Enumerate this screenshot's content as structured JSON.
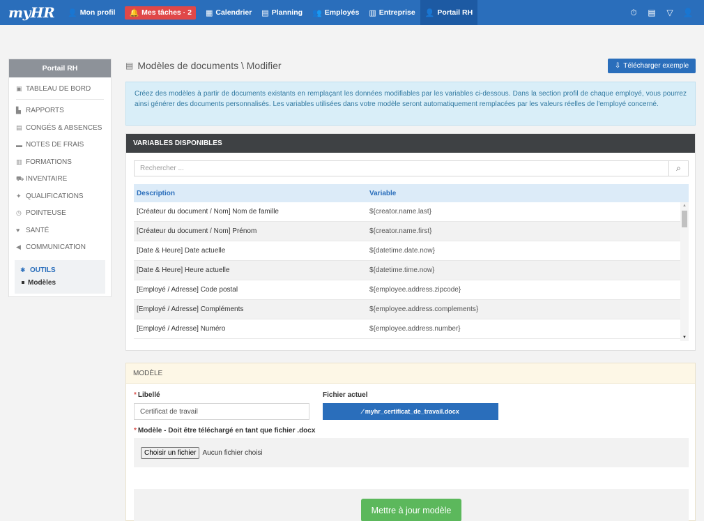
{
  "brand": "myHR",
  "nav": {
    "items": [
      {
        "icon": "👤",
        "label": "Mon profil"
      },
      {
        "icon": "🔔",
        "label": "Mes tâches · 2"
      },
      {
        "icon": "▦",
        "label": "Calendrier"
      },
      {
        "icon": "▤",
        "label": "Planning"
      },
      {
        "icon": "👥",
        "label": "Employés"
      },
      {
        "icon": "▥",
        "label": "Entreprise"
      },
      {
        "icon": "👤",
        "label": "Portail RH"
      }
    ],
    "right_icons": [
      "⏱",
      "▤",
      "▽",
      "👤"
    ]
  },
  "sidebar": {
    "title": "Portail RH",
    "items": [
      {
        "icon": "▣",
        "label": "TABLEAU DE BORD"
      },
      {
        "icon": "▙",
        "label": "RAPPORTS"
      },
      {
        "icon": "▤",
        "label": "CONGÉS & ABSENCES"
      },
      {
        "icon": "▬",
        "label": "NOTES DE FRAIS"
      },
      {
        "icon": "▥",
        "label": "FORMATIONS"
      },
      {
        "icon": "⛟",
        "label": "INVENTAIRE"
      },
      {
        "icon": "✦",
        "label": "QUALIFICATIONS"
      },
      {
        "icon": "◷",
        "label": "POINTEUSE"
      },
      {
        "icon": "♥",
        "label": "SANTÉ"
      },
      {
        "icon": "◀",
        "label": "COMMUNICATION"
      }
    ],
    "active": {
      "icon": "✱",
      "label": "OUTILS",
      "sub": "Modèles"
    }
  },
  "page": {
    "title_icon": "▤",
    "title": "Modèles de documents \\ Modifier",
    "download_icon": "⇩",
    "download_label": "Télécharger exemple",
    "info": "Créez des modèles à partir de documents existants en remplaçant les données modifiables par les variables ci-dessous. Dans la section profil de chaque employé, vous pourrez ainsi générer des documents personnalisés. Les variables utilisées dans votre modèle seront automatiquement remplacées par les valeurs réelles de l'employé concerné."
  },
  "variables": {
    "header": "VARIABLES DISPONIBLES",
    "search_placeholder": "Rechercher ...",
    "search_icon": "⌕",
    "col_desc": "Description",
    "col_var": "Variable",
    "rows": [
      {
        "desc": "[Créateur du document / Nom] Nom de famille",
        "var": "${creator.name.last}"
      },
      {
        "desc": "[Créateur du document / Nom] Prénom",
        "var": "${creator.name.first}"
      },
      {
        "desc": "[Date & Heure] Date actuelle",
        "var": "${datetime.date.now}"
      },
      {
        "desc": "[Date & Heure] Heure actuelle",
        "var": "${datetime.time.now}"
      },
      {
        "desc": "[Employé / Adresse] Code postal",
        "var": "${employee.address.zipcode}"
      },
      {
        "desc": "[Employé / Adresse] Compléments",
        "var": "${employee.address.complements}"
      },
      {
        "desc": "[Employé / Adresse] Numéro",
        "var": "${employee.address.number}"
      }
    ]
  },
  "model": {
    "header": "MODÈLE",
    "required_mark": "*",
    "libelle_label": "Libellé",
    "libelle_value": "Certificat de travail",
    "current_file_label": "Fichier actuel",
    "current_file_icon": "⁄",
    "current_file_name": "myhr_certificat_de_travail.docx",
    "upload_label": "Modèle - Doit être téléchargé en tant que fichier .docx",
    "choose_label": "Choisir un fichier",
    "no_file": "Aucun fichier choisi",
    "submit_label": "Mettre à jour modèle"
  }
}
